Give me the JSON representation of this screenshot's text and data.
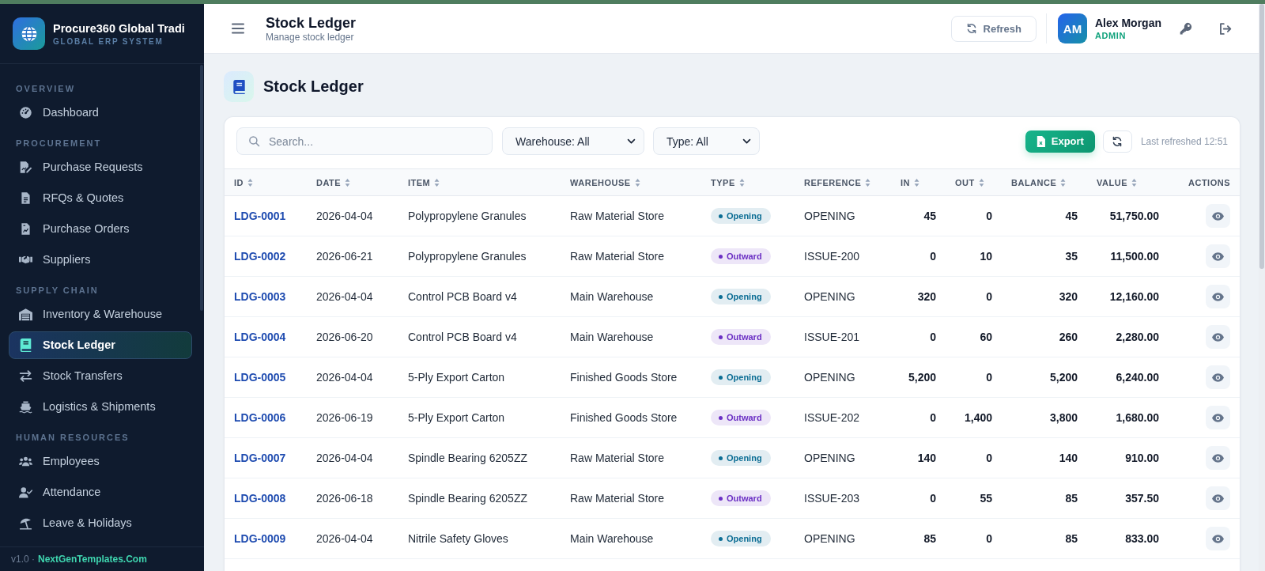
{
  "sidebar": {
    "brand": {
      "title": "Procure360 Global Tradi",
      "subtitle": "GLOBAL ERP SYSTEM"
    },
    "sections": [
      {
        "label": "OVERVIEW",
        "items": [
          {
            "label": "Dashboard",
            "selected": false
          }
        ]
      },
      {
        "label": "PROCUREMENT",
        "items": [
          {
            "label": "Purchase Requests",
            "selected": false
          },
          {
            "label": "RFQs & Quotes",
            "selected": false
          },
          {
            "label": "Purchase Orders",
            "selected": false
          },
          {
            "label": "Suppliers",
            "selected": false
          }
        ]
      },
      {
        "label": "SUPPLY CHAIN",
        "items": [
          {
            "label": "Inventory & Warehouse",
            "selected": false
          },
          {
            "label": "Stock Ledger",
            "selected": true
          },
          {
            "label": "Stock Transfers",
            "selected": false
          },
          {
            "label": "Logistics & Shipments",
            "selected": false
          }
        ]
      },
      {
        "label": "HUMAN RESOURCES",
        "items": [
          {
            "label": "Employees",
            "selected": false
          },
          {
            "label": "Attendance",
            "selected": false
          },
          {
            "label": "Leave & Holidays",
            "selected": false
          }
        ]
      }
    ],
    "footer": {
      "version": "v1.0 ·",
      "link": "NextGenTemplates.Com"
    }
  },
  "header": {
    "title": "Stock Ledger",
    "subtitle": "Manage stock ledger",
    "refresh_button": "Refresh",
    "user": {
      "initials": "AM",
      "name": "Alex Morgan",
      "role": "ADMIN"
    }
  },
  "page": {
    "title": "Stock Ledger"
  },
  "toolbar": {
    "search": {
      "placeholder": "Search..."
    },
    "filters": [
      {
        "value": "Warehouse: All"
      },
      {
        "value": "Type: All"
      }
    ],
    "export_button": "Export",
    "last_refreshed": "Last refreshed 12:51"
  },
  "table": {
    "columns": [
      {
        "label": "ID",
        "sortable": true
      },
      {
        "label": "DATE",
        "sortable": true
      },
      {
        "label": "ITEM",
        "sortable": true
      },
      {
        "label": "WAREHOUSE",
        "sortable": true
      },
      {
        "label": "TYPE",
        "sortable": true
      },
      {
        "label": "REFERENCE",
        "sortable": true
      },
      {
        "label": "IN",
        "sortable": true
      },
      {
        "label": "OUT",
        "sortable": true
      },
      {
        "label": "BALANCE",
        "sortable": true
      },
      {
        "label": "VALUE",
        "sortable": true
      },
      {
        "label": "ACTIONS",
        "sortable": false
      }
    ],
    "rows": [
      {
        "id": "LDG-0001",
        "date": "2026-04-04",
        "item": "Polypropylene Granules",
        "warehouse": "Raw Material Store",
        "type": {
          "label": "Opening",
          "color": "#0b6d94"
        },
        "reference": "OPENING",
        "in": "45",
        "out": "0",
        "balance": "45",
        "value": "51,750.00"
      },
      {
        "id": "LDG-0002",
        "date": "2026-06-21",
        "item": "Polypropylene Granules",
        "warehouse": "Raw Material Store",
        "type": {
          "label": "Outward",
          "color": "#6b2fc4"
        },
        "reference": "ISSUE-200",
        "in": "0",
        "out": "10",
        "balance": "35",
        "value": "11,500.00"
      },
      {
        "id": "LDG-0003",
        "date": "2026-04-04",
        "item": "Control PCB Board v4",
        "warehouse": "Main Warehouse",
        "type": {
          "label": "Opening",
          "color": "#0b6d94"
        },
        "reference": "OPENING",
        "in": "320",
        "out": "0",
        "balance": "320",
        "value": "12,160.00"
      },
      {
        "id": "LDG-0004",
        "date": "2026-06-20",
        "item": "Control PCB Board v4",
        "warehouse": "Main Warehouse",
        "type": {
          "label": "Outward",
          "color": "#6b2fc4"
        },
        "reference": "ISSUE-201",
        "in": "0",
        "out": "60",
        "balance": "260",
        "value": "2,280.00"
      },
      {
        "id": "LDG-0005",
        "date": "2026-04-04",
        "item": "5-Ply Export Carton",
        "warehouse": "Finished Goods Store",
        "type": {
          "label": "Opening",
          "color": "#0b6d94"
        },
        "reference": "OPENING",
        "in": "5,200",
        "out": "0",
        "balance": "5,200",
        "value": "6,240.00"
      },
      {
        "id": "LDG-0006",
        "date": "2026-06-19",
        "item": "5-Ply Export Carton",
        "warehouse": "Finished Goods Store",
        "type": {
          "label": "Outward",
          "color": "#6b2fc4"
        },
        "reference": "ISSUE-202",
        "in": "0",
        "out": "1,400",
        "balance": "3,800",
        "value": "1,680.00"
      },
      {
        "id": "LDG-0007",
        "date": "2026-04-04",
        "item": "Spindle Bearing 6205ZZ",
        "warehouse": "Raw Material Store",
        "type": {
          "label": "Opening",
          "color": "#0b6d94"
        },
        "reference": "OPENING",
        "in": "140",
        "out": "0",
        "balance": "140",
        "value": "910.00"
      },
      {
        "id": "LDG-0008",
        "date": "2026-06-18",
        "item": "Spindle Bearing 6205ZZ",
        "warehouse": "Raw Material Store",
        "type": {
          "label": "Outward",
          "color": "#6b2fc4"
        },
        "reference": "ISSUE-203",
        "in": "0",
        "out": "55",
        "balance": "85",
        "value": "357.50"
      },
      {
        "id": "LDG-0009",
        "date": "2026-04-04",
        "item": "Nitrile Safety Gloves",
        "warehouse": "Main Warehouse",
        "type": {
          "label": "Opening",
          "color": "#0b6d94"
        },
        "reference": "OPENING",
        "in": "85",
        "out": "0",
        "balance": "85",
        "value": "833.00"
      }
    ]
  }
}
